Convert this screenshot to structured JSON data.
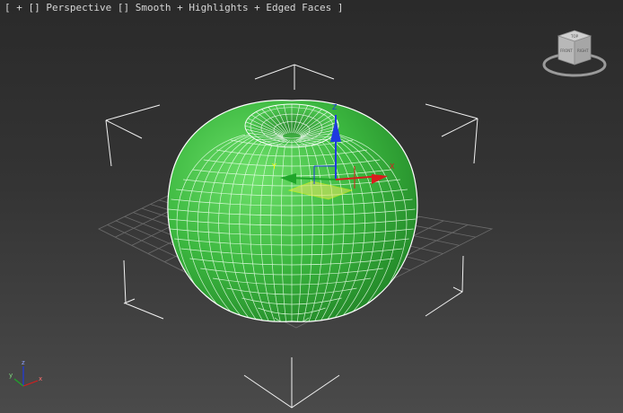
{
  "viewport": {
    "label_parts": {
      "open_bracket": "[",
      "plus": "+",
      "view_name": "Perspective",
      "shading_mode": "Smooth + Highlights + Edged Faces",
      "close_bracket": "]"
    }
  },
  "viewcube": {
    "top_face_label": "TOP",
    "front_face_label": "FRONT",
    "right_face_label": "RIGHT"
  },
  "gizmo": {
    "x_label": "X",
    "y_label": "Y",
    "z_label": "Z"
  },
  "axis_tripod": {
    "x_label": "x",
    "y_label": "y",
    "z_label": "z"
  },
  "colors": {
    "object_green": "#3cb840",
    "x_axis": "#d81d1d",
    "y_axis": "#1fa52a",
    "z_axis": "#1f3ae0",
    "selection_brackets": "#f2f2f2",
    "grid": "#6c6c6c"
  }
}
